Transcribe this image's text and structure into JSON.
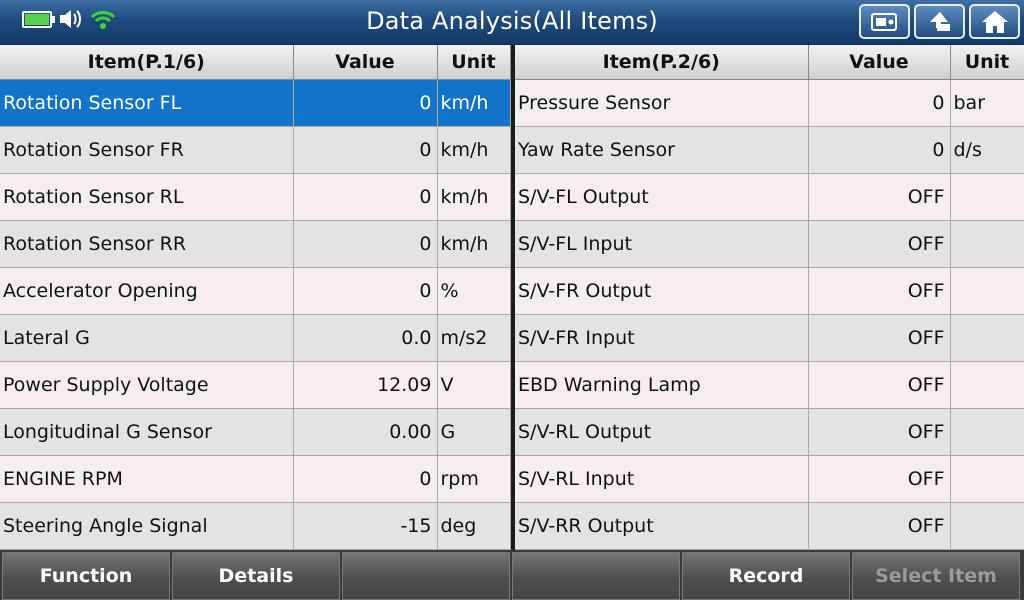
{
  "header": {
    "title": "Data Analysis(All Items)",
    "buttons": [
      {
        "icon": "screenshot-icon"
      },
      {
        "icon": "back-arrow-icon"
      },
      {
        "icon": "home-icon"
      }
    ]
  },
  "status": {
    "battery_icon": "battery-charging-icon",
    "volume_icon": "speaker-icon",
    "wifi_icon": "wifi-icon",
    "battery_color": "#55d24a",
    "wifi_color": "#3bd43b"
  },
  "left_table": {
    "headers": {
      "item": "Item(P.1/6)",
      "value": "Value",
      "unit": "Unit"
    },
    "rows": [
      {
        "item": "Rotation Sensor FL",
        "value": "0",
        "unit": "km/h",
        "selected": true
      },
      {
        "item": "Rotation Sensor FR",
        "value": "0",
        "unit": "km/h"
      },
      {
        "item": "Rotation Sensor RL",
        "value": "0",
        "unit": "km/h"
      },
      {
        "item": "Rotation Sensor RR",
        "value": "0",
        "unit": "km/h"
      },
      {
        "item": "Accelerator Opening",
        "value": "0",
        "unit": "%"
      },
      {
        "item": "Lateral G",
        "value": "0.0",
        "unit": "m/s2"
      },
      {
        "item": "Power Supply Voltage",
        "value": "12.09",
        "unit": "V"
      },
      {
        "item": "Longitudinal G Sensor",
        "value": "0.00",
        "unit": "G"
      },
      {
        "item": "ENGINE RPM",
        "value": "0",
        "unit": "rpm"
      },
      {
        "item": "Steering Angle Signal",
        "value": "-15",
        "unit": "deg"
      }
    ]
  },
  "right_table": {
    "headers": {
      "item": "Item(P.2/6)",
      "value": "Value",
      "unit": "Unit"
    },
    "rows": [
      {
        "item": "Pressure Sensor",
        "value": "0",
        "unit": "bar"
      },
      {
        "item": "Yaw Rate Sensor",
        "value": "0",
        "unit": "d/s"
      },
      {
        "item": "S/V-FL Output",
        "value": "OFF",
        "unit": ""
      },
      {
        "item": "S/V-FL Input",
        "value": "OFF",
        "unit": ""
      },
      {
        "item": "S/V-FR Output",
        "value": "OFF",
        "unit": ""
      },
      {
        "item": "S/V-FR Input",
        "value": "OFF",
        "unit": ""
      },
      {
        "item": "EBD Warning Lamp",
        "value": "OFF",
        "unit": ""
      },
      {
        "item": "S/V-RL Output",
        "value": "OFF",
        "unit": ""
      },
      {
        "item": "S/V-RL Input",
        "value": "OFF",
        "unit": ""
      },
      {
        "item": "S/V-RR Output",
        "value": "OFF",
        "unit": ""
      }
    ]
  },
  "footer": {
    "buttons": [
      {
        "label": "Function",
        "enabled": true
      },
      {
        "label": "Details",
        "enabled": true
      },
      {
        "label": "",
        "enabled": true
      },
      {
        "label": "",
        "enabled": true
      },
      {
        "label": "Record",
        "enabled": true
      },
      {
        "label": "Select Item",
        "enabled": false
      }
    ]
  }
}
